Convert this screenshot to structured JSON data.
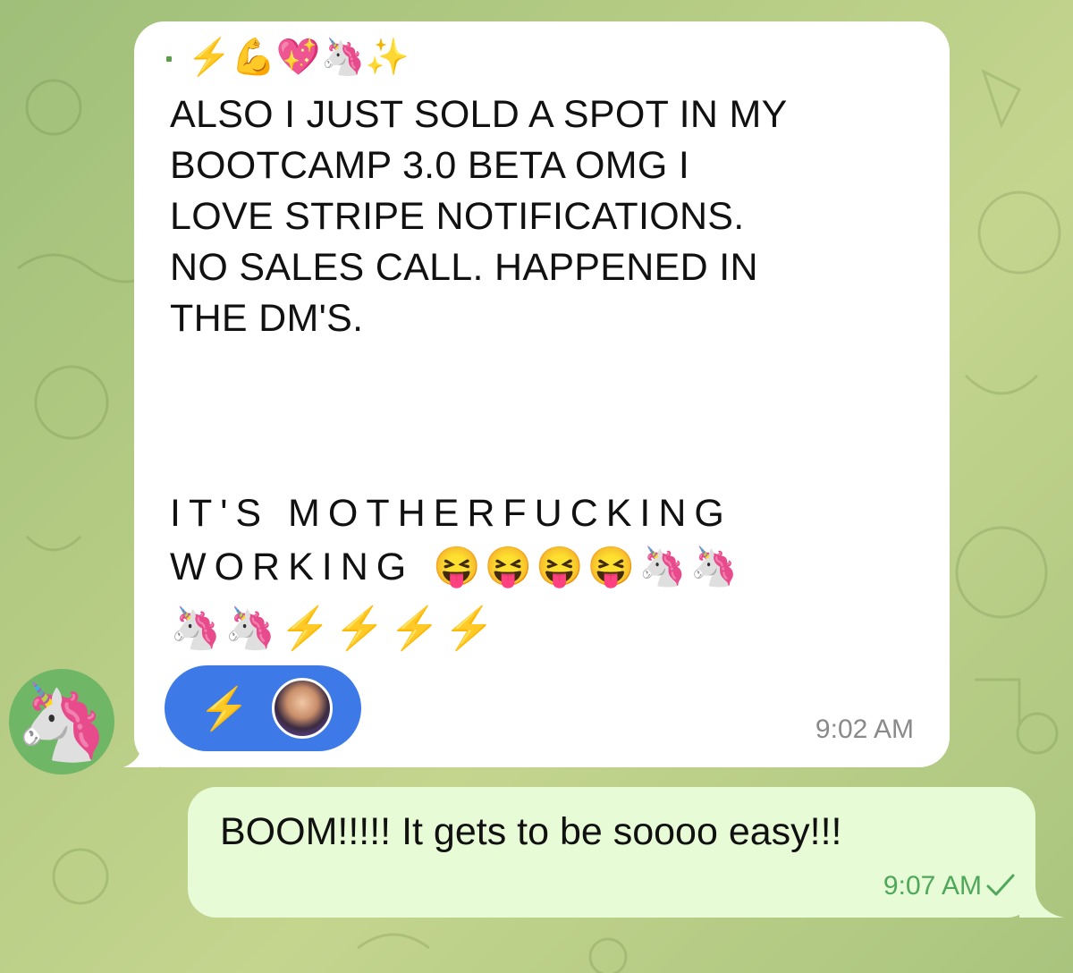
{
  "colors": {
    "incoming_bubble": "#ffffff",
    "outgoing_bubble": "#e7fbd6",
    "reaction_pill": "#3d7ae8",
    "outgoing_time": "#4fa85a"
  },
  "incoming_message": {
    "top_emojis": "⚡💪💖🦄✨",
    "text_lines": [
      "ALSO I JUST SOLD A SPOT IN MY",
      "BOOTCAMP 3.0 BETA OMG I",
      "LOVE STRIPE NOTIFICATIONS.",
      "NO SALES CALL. HAPPENED IN",
      "THE DM'S."
    ],
    "spaced_text_1": "IT'S MOTHERFUCKING",
    "spaced_text_2": "WORKING",
    "emojis_inline": "😝😝😝😝🦄🦄",
    "emoji_line": "🦄🦄⚡⚡⚡⚡",
    "reaction": {
      "emoji": "⚡",
      "avatar_icon": "user-avatar"
    },
    "time": "9:02 AM",
    "sender_avatar_emoji": "🦄"
  },
  "outgoing_message": {
    "text": "BOOM!!!!! It gets to be soooo easy!!!",
    "time": "9:07 AM",
    "status_icon": "check-icon"
  }
}
